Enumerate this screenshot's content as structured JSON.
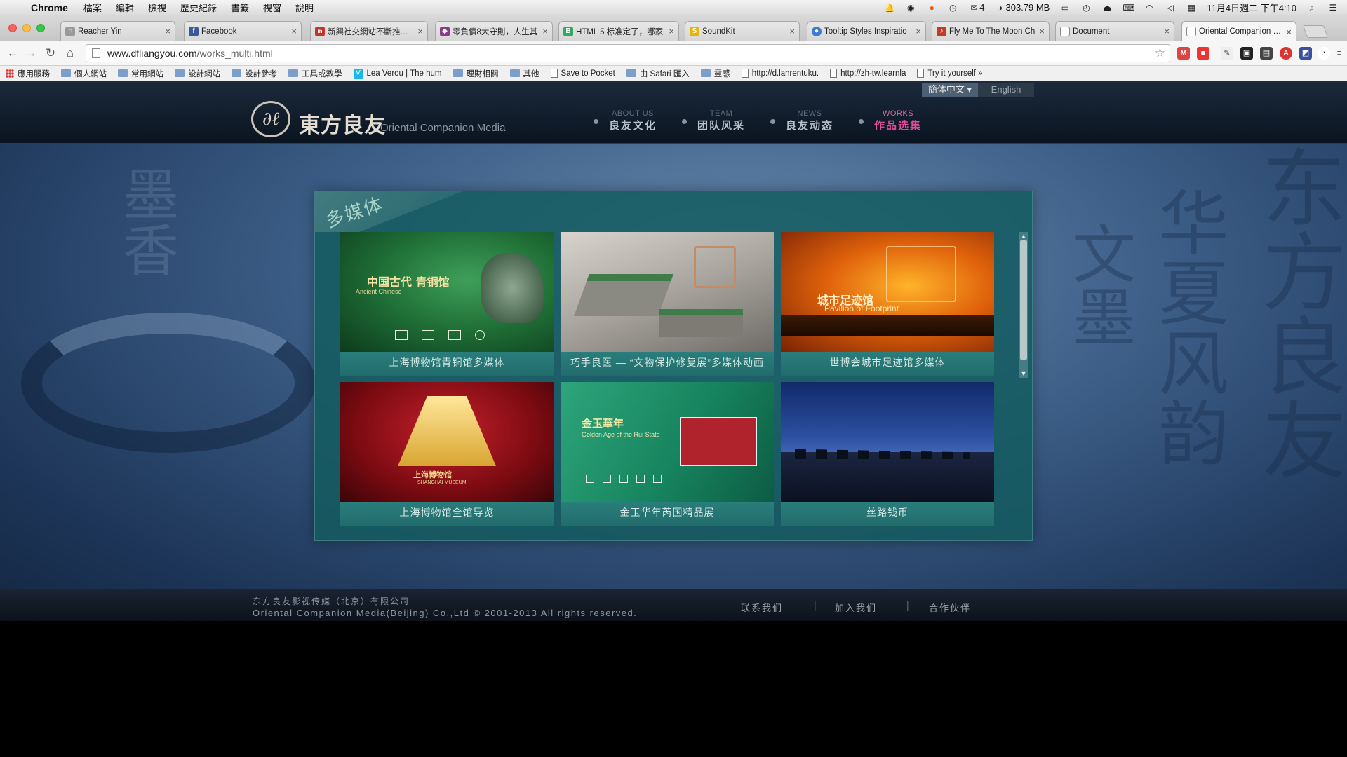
{
  "menubar": {
    "app": "Chrome",
    "menus": [
      "檔案",
      "編輯",
      "檢視",
      "歷史紀錄",
      "書籤",
      "視窗",
      "說明"
    ],
    "memory": "303.79 MB",
    "counter": "4",
    "clock": "11月4日週二 下午4:10"
  },
  "tabs": [
    {
      "title": "Reacher Yin",
      "fav": "○",
      "color": "#777"
    },
    {
      "title": "Facebook",
      "fav": "f",
      "color": "#3b5998"
    },
    {
      "title": "新興社交網站不斷推出，",
      "fav": "in",
      "color": "#c4302b"
    },
    {
      "title": "零負債8大守則，人生其",
      "fav": "◆",
      "color": "#8a3a8a"
    },
    {
      "title": "HTML 5 标准定了，哪家",
      "fav": "B",
      "color": "#2bab5e"
    },
    {
      "title": "SoundKit",
      "fav": "S",
      "color": "#e7b400"
    },
    {
      "title": "Tooltip Styles Inspiratio",
      "fav": "●",
      "color": "#3a7bd5"
    },
    {
      "title": "Fly Me To The Moon Ch",
      "fav": "♪",
      "color": "#c23b22"
    },
    {
      "title": "Document",
      "fav": "",
      "color": "#ffffff"
    },
    {
      "title": "Oriental Companion Me",
      "fav": "",
      "color": "#ffffff"
    }
  ],
  "omnibox": {
    "domain": "www.dfliangyou.com",
    "path": "/works_multi.html"
  },
  "bookmarks": [
    {
      "label": "應用服務",
      "kind": "grid"
    },
    {
      "label": "個人網站",
      "kind": "folder"
    },
    {
      "label": "常用網站",
      "kind": "folder"
    },
    {
      "label": "設計網站",
      "kind": "folder"
    },
    {
      "label": "設計參考",
      "kind": "folder"
    },
    {
      "label": "工具或教學",
      "kind": "folder"
    },
    {
      "label": "Lea Verou | The hum",
      "kind": "vimeo"
    },
    {
      "label": "理財相關",
      "kind": "folder"
    },
    {
      "label": "其他",
      "kind": "folder"
    },
    {
      "label": "Save to Pocket",
      "kind": "page"
    },
    {
      "label": "由 Safari 匯入",
      "kind": "folder"
    },
    {
      "label": "靈感",
      "kind": "folder"
    },
    {
      "label": "http://d.lanrentuku.",
      "kind": "page"
    },
    {
      "label": "http://zh-tw.learnla",
      "kind": "page"
    },
    {
      "label": "Try it yourself »",
      "kind": "page"
    }
  ],
  "site": {
    "logo_cn": "東方良友",
    "logo_en": "Oriental Companion Media",
    "nav": [
      {
        "en": "ABOUT US",
        "cn": "良友文化"
      },
      {
        "en": "TEAM",
        "cn": "团队风采"
      },
      {
        "en": "NEWS",
        "cn": "良友动态"
      },
      {
        "en": "WORKS",
        "cn": "作品选集"
      }
    ],
    "lang_current": "簡体中文",
    "lang_alt": "English",
    "panel_title": "多媒体",
    "works": [
      {
        "caption": "上海博物馆青铜馆多媒体",
        "thumb_title": "中国古代 青铜馆",
        "thumb_sub": "Ancient Chinese"
      },
      {
        "caption": "巧手良医 — “文物保护修复展”多媒体动画",
        "thumb_title": "",
        "thumb_sub": ""
      },
      {
        "caption": "世博会城市足迹馆多媒体",
        "thumb_title": "城市足迹馆",
        "thumb_sub": "Pavilion of Footprint"
      },
      {
        "caption": "上海博物馆全馆导览",
        "thumb_title": "上海博物馆",
        "thumb_sub": "SHANGHAI MUSEUM"
      },
      {
        "caption": "金玉华年芮国精品展",
        "thumb_title": "金玉華年",
        "thumb_sub": "Golden Age of the Rui State"
      },
      {
        "caption": "丝路钱币",
        "thumb_title": "",
        "thumb_sub": ""
      }
    ],
    "footer_cn": "东方良友影视传媒（北京）有限公司",
    "footer_en": "Oriental Companion Media(Beijing) Co.,Ltd © 2001-2013 All rights reserved.",
    "footer_links": [
      "联系我们",
      "加入我们",
      "合作伙伴"
    ]
  }
}
